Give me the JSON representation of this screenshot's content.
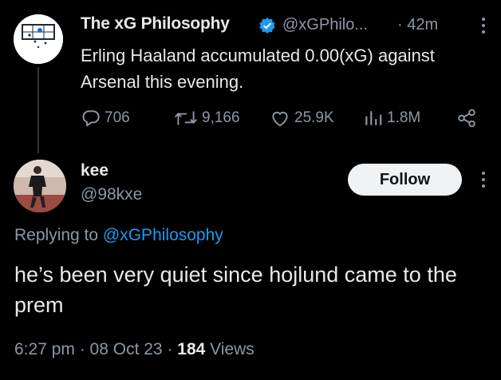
{
  "parent_tweet": {
    "display_name": "The xG Philosophy",
    "handle": "@xGPhilo...",
    "time": "· 42m",
    "text": "Erling Haaland accumulated 0.00(xG) against Arsenal this evening.",
    "stats": {
      "replies": "706",
      "retweets": "9,166",
      "likes": "25.9K",
      "views": "1.8M"
    }
  },
  "reply_tweet": {
    "display_name": "kee",
    "handle": "@98kxe",
    "follow_label": "Follow",
    "replying_prefix": "Replying to",
    "replying_to": "@xGPhilosophy",
    "text": "he’s been very quiet since hojlund came to the prem",
    "time": "6:27 pm · 08 Oct 23 · ",
    "views_count": "184",
    "views_label": " Views"
  },
  "colors": {
    "background": "#000000",
    "text": "#e7e9ea",
    "secondary": "#8b98a5",
    "link": "#1d9bf0",
    "verified": "#1d9bf0",
    "follow_bg": "#eff3f4"
  },
  "icons": [
    "verified-badge-icon",
    "more-icon",
    "reply-icon",
    "retweet-icon",
    "like-icon",
    "views-icon",
    "share-icon"
  ]
}
